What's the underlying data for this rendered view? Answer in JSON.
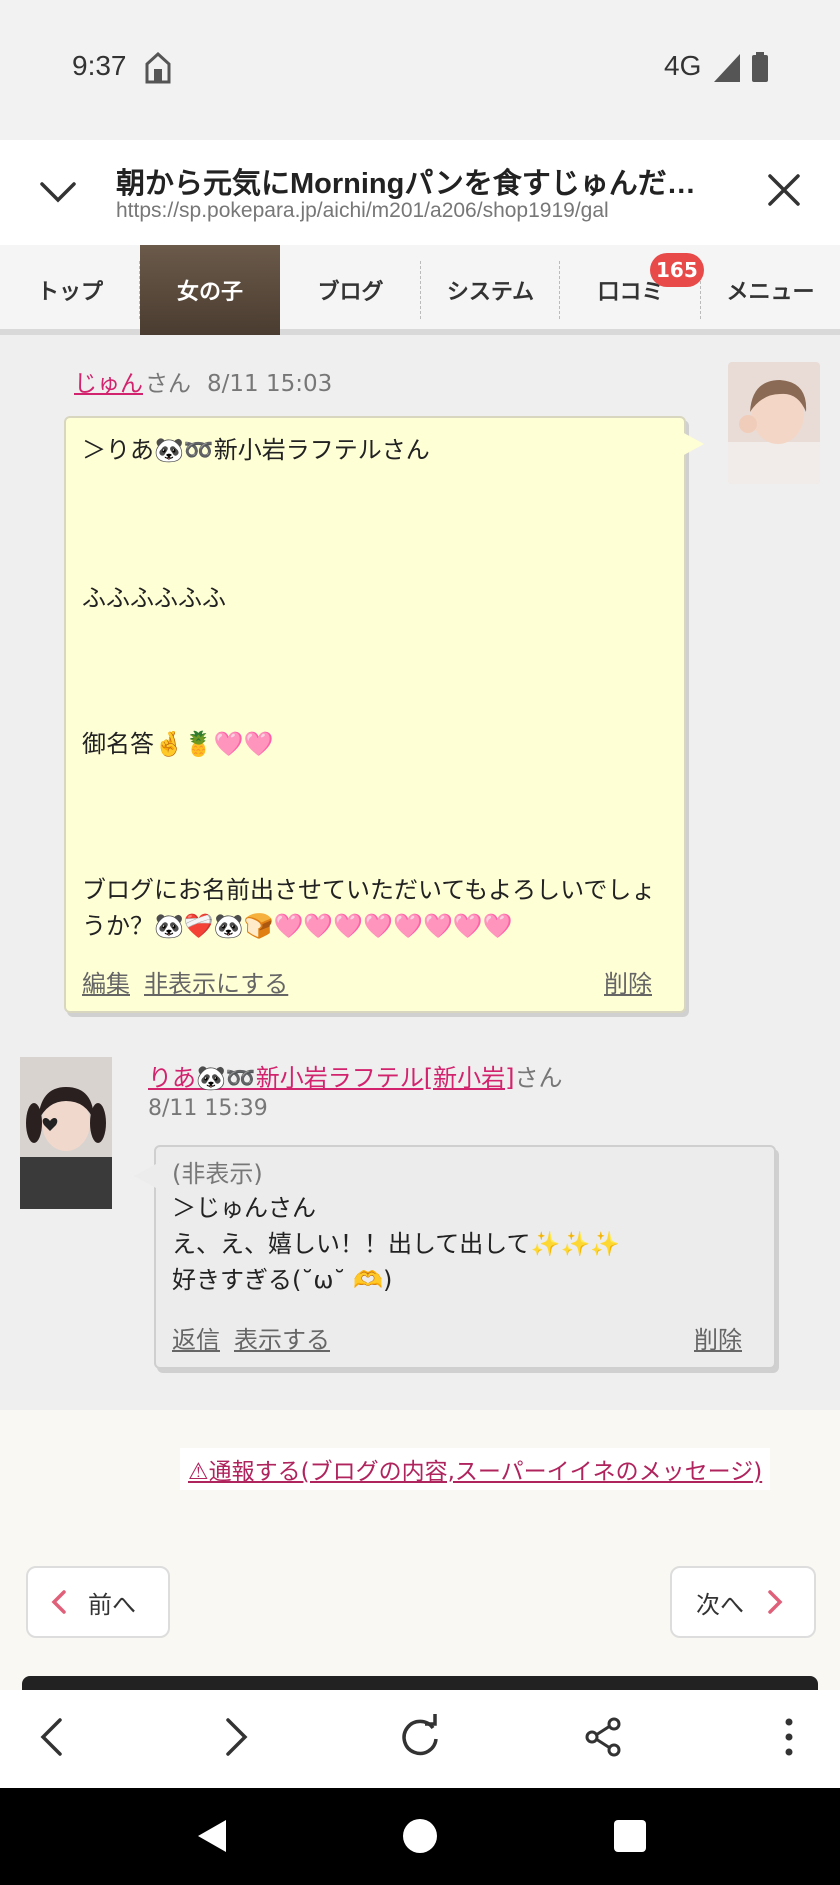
{
  "status": {
    "time": "9:37",
    "network": "4G"
  },
  "browser": {
    "page_title": "朝から元気にMorningパンを食すじゅんだ…",
    "url": "https://sp.pokepara.jp/aichi/m201/a206/shop1919/gal"
  },
  "tabs": [
    {
      "label": "トップ"
    },
    {
      "label": "女の子",
      "active": true
    },
    {
      "label": "ブログ"
    },
    {
      "label": "システム"
    },
    {
      "label": "口コミ",
      "badge": "165"
    },
    {
      "label": "メニュー"
    }
  ],
  "comment1": {
    "author": "じゅん",
    "suffix": "さん",
    "timestamp": "8/11 15:03",
    "lines": [
      "＞りあ🐼➿新小岩ラフテルさん",
      "ふふふふふふ",
      "御名答🤞🍍🩷🩷",
      "ブログにお名前出させていただいてもよろしいでしょうか？🐼❤️‍🩹🐼🍞🩷🩷🩷🩷🩷🩷🩷🩷"
    ],
    "edit_label": "編集",
    "hide_label": "非表示にする",
    "delete_label": "削除"
  },
  "comment2": {
    "author": "りあ🐼➿新小岩ラフテル[新小岩]",
    "suffix": "さん",
    "timestamp": "8/11 15:39",
    "hidden_note": "(非表示)",
    "lines": [
      "＞じゅんさん",
      "え、え、嬉しい！！出して出して✨✨✨",
      "好きすぎる(˘ω˘ 🫶)"
    ],
    "reply_label": "返信",
    "show_label": "表示する",
    "delete_label": "削除"
  },
  "report_link": "⚠通報する(ブログの内容,スーパーイイネのメッセージ)",
  "pager": {
    "prev": "前へ",
    "next": "次へ"
  },
  "colors": {
    "accent": "#d2246e",
    "tab_active": "#5a4a3c",
    "badge": "#e84a4a",
    "bubble_yellow": "#ffffd6"
  },
  "toolbar_icons": [
    "back-icon",
    "forward-icon",
    "reload-icon",
    "share-icon",
    "more-icon"
  ],
  "nav_icons": [
    "nav-back-icon",
    "nav-home-icon",
    "nav-recents-icon"
  ]
}
